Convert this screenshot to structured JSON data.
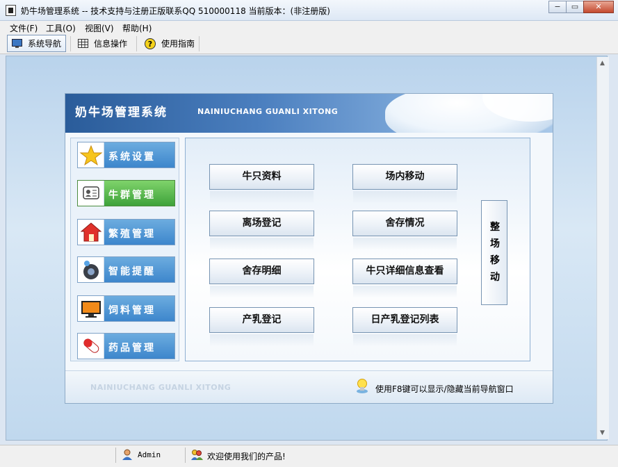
{
  "window": {
    "title": "奶牛场管理系统 -- 技术支持与注册正版联系QQ 510000118   当前版本：(非注册版)",
    "minimize_glyph": "−",
    "maximize_glyph": "▭",
    "close_glyph": "✕"
  },
  "menu": {
    "file": "文件(F)",
    "tools": "工具(O)",
    "view": "视图(V)",
    "help": "帮助(H)"
  },
  "toolbar": {
    "nav": "系统导航",
    "info": "信息操作",
    "guide": "使用指南"
  },
  "banner": {
    "title_cn": "奶牛场管理系统",
    "title_en": "NAINIUCHANG GUANLI XITONG"
  },
  "sidebar": {
    "items": [
      {
        "label": "系统设置",
        "icon": "star-icon"
      },
      {
        "label": "牛群管理",
        "icon": "id-card-icon",
        "selected": true
      },
      {
        "label": "繁殖管理",
        "icon": "house-icon"
      },
      {
        "label": "智能提醒",
        "icon": "speaker-icon"
      },
      {
        "label": "饲料管理",
        "icon": "monitor-icon"
      },
      {
        "label": "药品管理",
        "icon": "pill-icon"
      }
    ]
  },
  "main": {
    "buttons": {
      "cattle_info": "牛只资料",
      "move_in_farm": "场内移动",
      "leave_register": "离场登记",
      "barn_status": "舍存情况",
      "barn_detail": "舍存明细",
      "cattle_detail_query": "牛只详细信息查看",
      "milk_register": "产乳登记",
      "daily_milk_list": "日产乳登记列表"
    },
    "vertical_button": {
      "chars": [
        "整",
        "场",
        "移",
        "动"
      ]
    }
  },
  "footer": {
    "brand_en": "NAINIUCHANG GUANLI XITONG",
    "tip": "使用F8键可以显示/隐藏当前导航窗口"
  },
  "statusbar": {
    "user": "Admin",
    "welcome": "欢迎使用我们的产品!"
  },
  "colors": {
    "banner": "#3a6cab",
    "side_button": "#4a90d2",
    "side_button_selected": "#4caf45",
    "client_bg": "#c9def1"
  }
}
